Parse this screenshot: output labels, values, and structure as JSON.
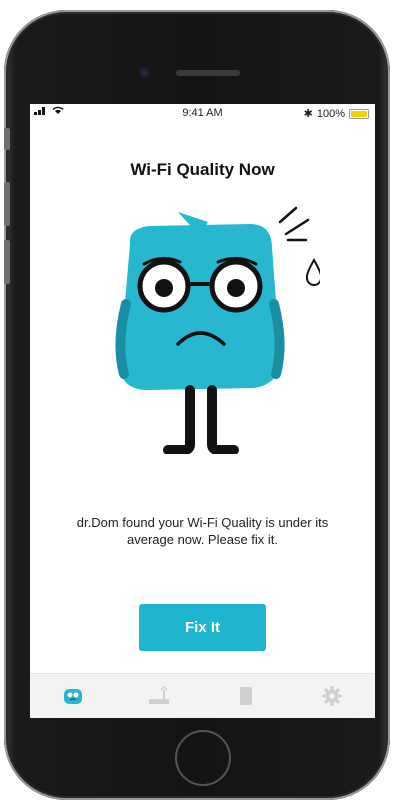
{
  "status_bar": {
    "signal": "▮▮▮",
    "time": "9:41 AM",
    "bluetooth": "✱",
    "battery_percent": "100%"
  },
  "screen": {
    "title": "Wi-Fi Quality Now",
    "message": "dr.Dom found your Wi-Fi Quality is under its average now. Please fix it.",
    "fix_button_label": "Fix It"
  },
  "colors": {
    "accent": "#1fb5cf",
    "mascot_body": "#27b8cf",
    "battery": "#f5d100"
  },
  "tab_bar": {
    "tabs": [
      {
        "name": "home",
        "icon": "mascot-icon",
        "active": true
      },
      {
        "name": "router",
        "icon": "router-icon",
        "active": false
      },
      {
        "name": "device",
        "icon": "phone-icon",
        "active": false
      },
      {
        "name": "settings",
        "icon": "gear-icon",
        "active": false
      }
    ]
  }
}
